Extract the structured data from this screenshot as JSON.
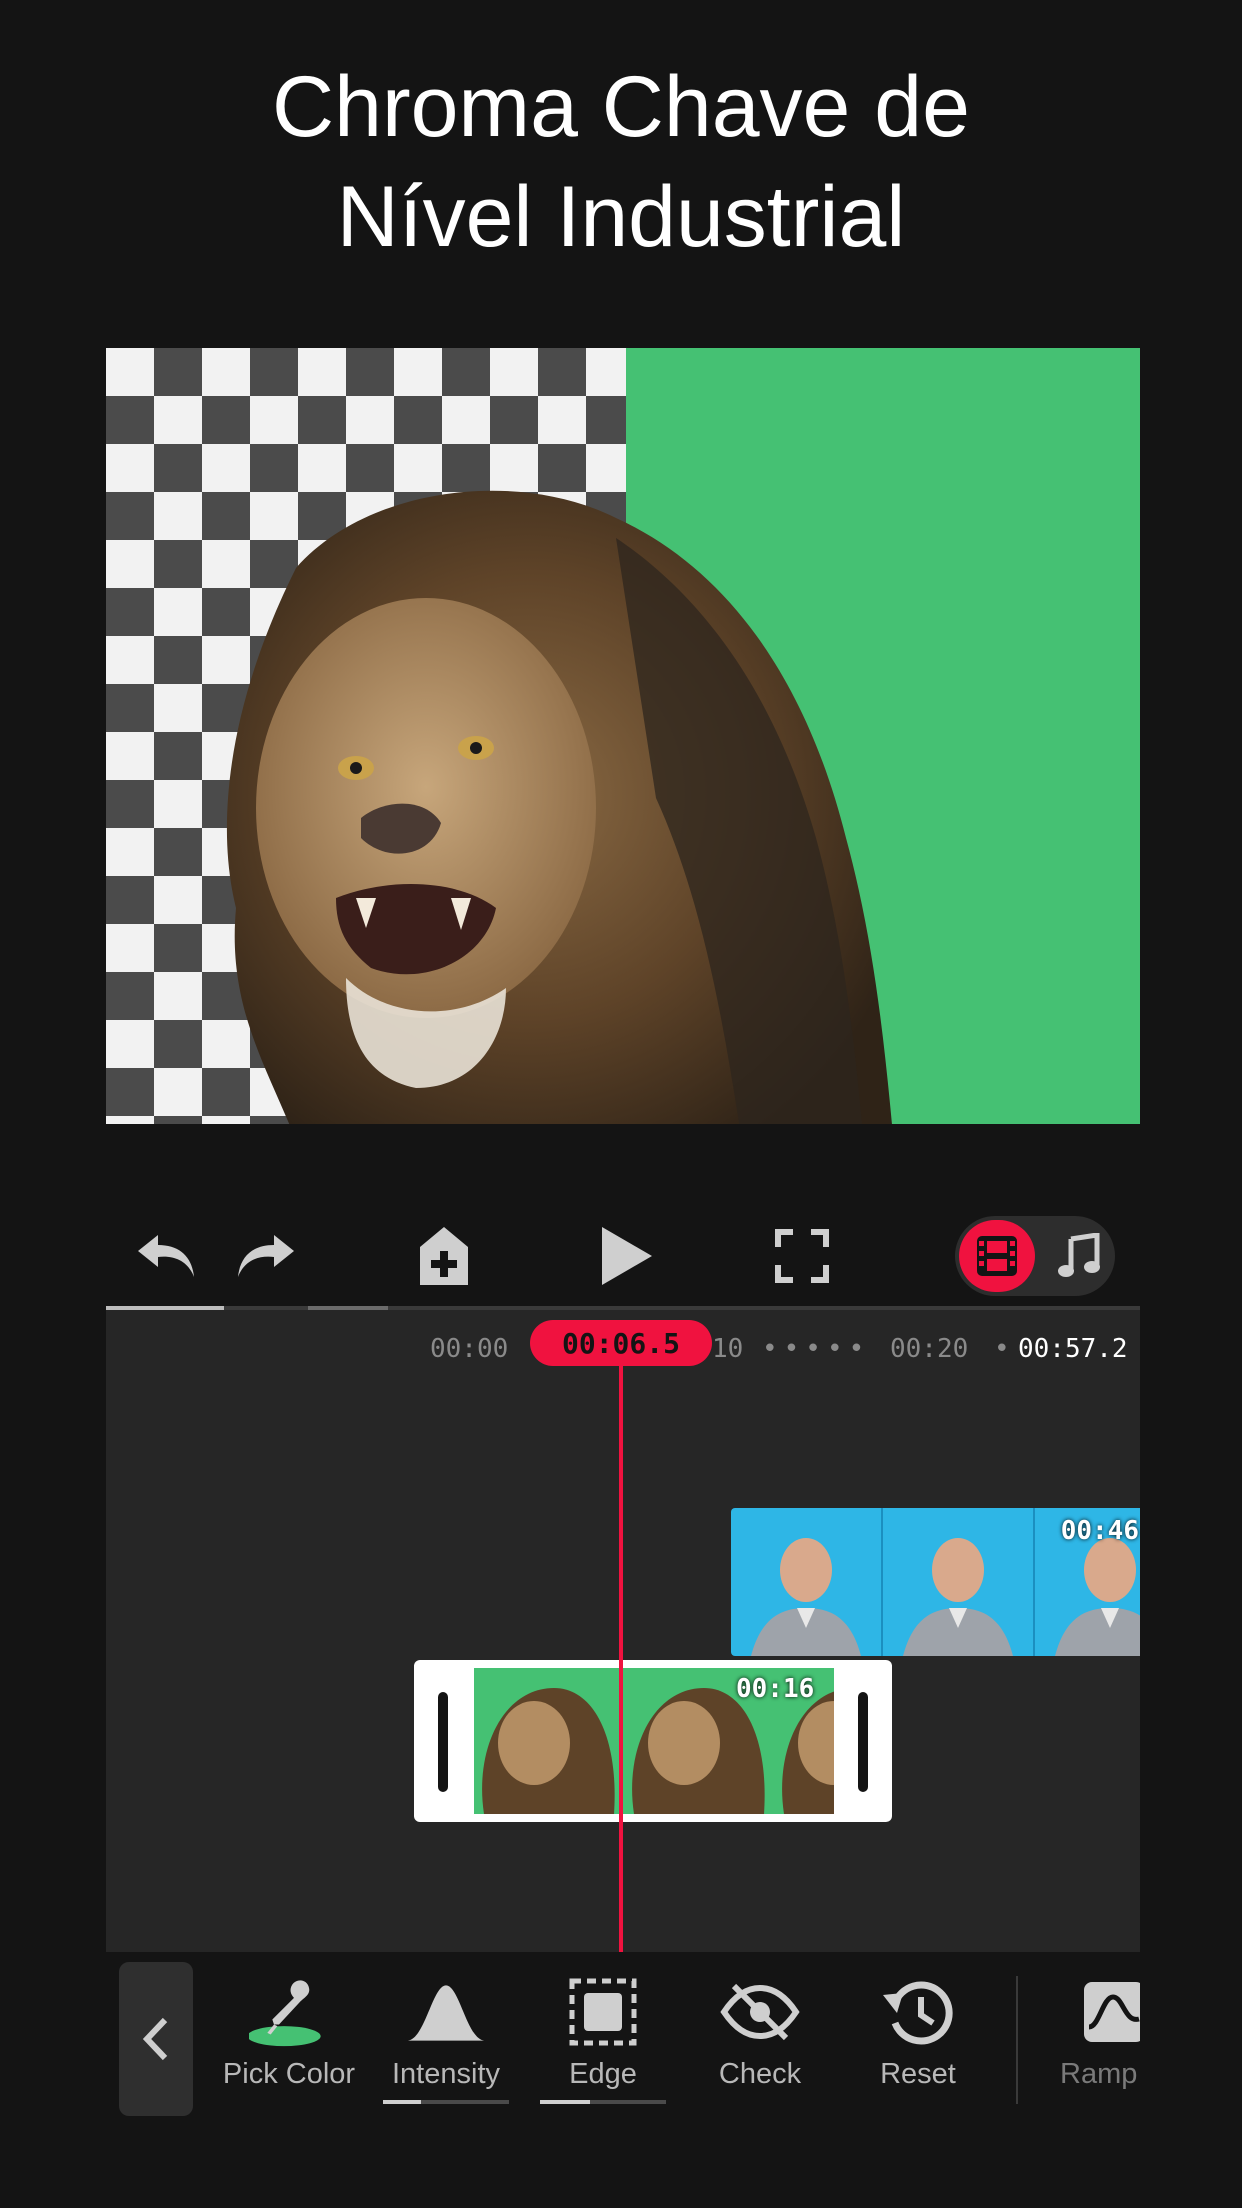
{
  "headline": {
    "line1": "Chroma Chave de",
    "line2": "Nível Industrial"
  },
  "toolbar": {
    "icons": [
      "undo-icon",
      "redo-icon",
      "add-media-icon",
      "play-icon",
      "fullscreen-icon",
      "film-icon",
      "music-icon"
    ],
    "mode_active": "video"
  },
  "timeline": {
    "ruler": {
      "t0": "00:00",
      "t10": "10",
      "dots": "•••••",
      "t20": "00:20",
      "dot2": "•",
      "total": "00:57.2"
    },
    "playhead": "00:06.5",
    "clips": [
      {
        "name": "man-clip",
        "duration": "00:46"
      },
      {
        "name": "lion-clip",
        "duration": "00:16",
        "selected": true
      }
    ]
  },
  "tools": {
    "items": [
      {
        "label": "Pick Color",
        "icon": "eyedropper-icon"
      },
      {
        "label": "Intensity",
        "icon": "bell-curve-icon",
        "level": 0.3
      },
      {
        "label": "Edge",
        "icon": "edge-square-icon",
        "level": 0.4
      },
      {
        "label": "Check",
        "icon": "eye-slash-icon"
      },
      {
        "label": "Reset",
        "icon": "history-icon"
      },
      {
        "label": "Ramp",
        "icon": "ramp-icon"
      }
    ]
  },
  "colors": {
    "accent": "#f0123f",
    "green": "#45c173",
    "blue": "#2eb6e6",
    "bg": "#141414"
  }
}
